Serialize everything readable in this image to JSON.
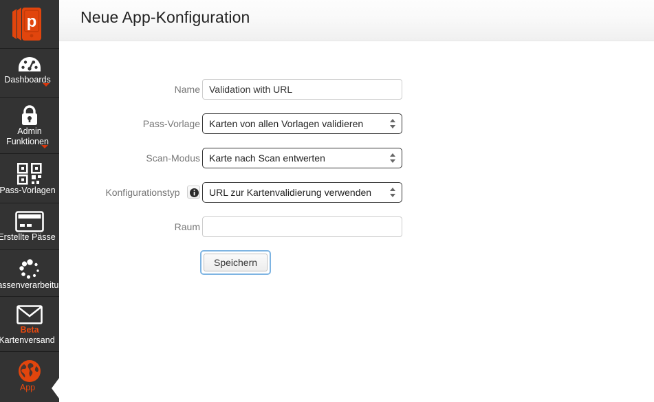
{
  "brand": {
    "logo_icon": "passcreator-logo-icon",
    "accent_color": "#e8490f",
    "sidebar_bg": "#333333"
  },
  "sidebar": {
    "items": [
      {
        "icon": "dashboard-gauge-icon",
        "label": "Dashboards",
        "has_caret": true,
        "sub_label": "",
        "beta": "",
        "active": false
      },
      {
        "icon": "lock-icon",
        "label": "Admin",
        "sub_label": "Funktionen",
        "has_caret": true,
        "beta": "",
        "active": false
      },
      {
        "icon": "qr-code-icon",
        "label": "Pass-Vorlagen",
        "has_caret": false,
        "sub_label": "",
        "beta": "",
        "active": false
      },
      {
        "icon": "credit-card-icon",
        "label": "Erstellte Pässe",
        "has_caret": false,
        "sub_label": "",
        "beta": "",
        "active": false
      },
      {
        "icon": "spinner-icon",
        "label": "Passenverarbeitung",
        "has_caret": false,
        "sub_label": "",
        "beta": "",
        "active": false
      },
      {
        "icon": "envelope-icon",
        "label": "Kartenversand",
        "has_caret": false,
        "sub_label": "",
        "beta": "Beta",
        "active": false
      },
      {
        "icon": "globe-icon",
        "label": "App",
        "has_caret": false,
        "sub_label": "",
        "beta": "",
        "active": true
      }
    ]
  },
  "header": {
    "title": "Neue App-Konfiguration"
  },
  "form": {
    "rows": [
      {
        "label": "Name",
        "type": "text",
        "value": "Validation with URL",
        "placeholder": ""
      },
      {
        "label": "Pass-Vorlage",
        "type": "select",
        "value": "Karten von allen Vorlagen validieren"
      },
      {
        "label": "Scan-Modus",
        "type": "select",
        "value": "Karte nach Scan entwerten"
      },
      {
        "label": "Konfigurationstyp",
        "type": "select",
        "value": "URL zur Kartenvalidierung verwenden",
        "info_icon": "info-icon"
      },
      {
        "label": "Raum",
        "type": "text",
        "value": "",
        "placeholder": ""
      }
    ],
    "save_label": "Speichern"
  }
}
